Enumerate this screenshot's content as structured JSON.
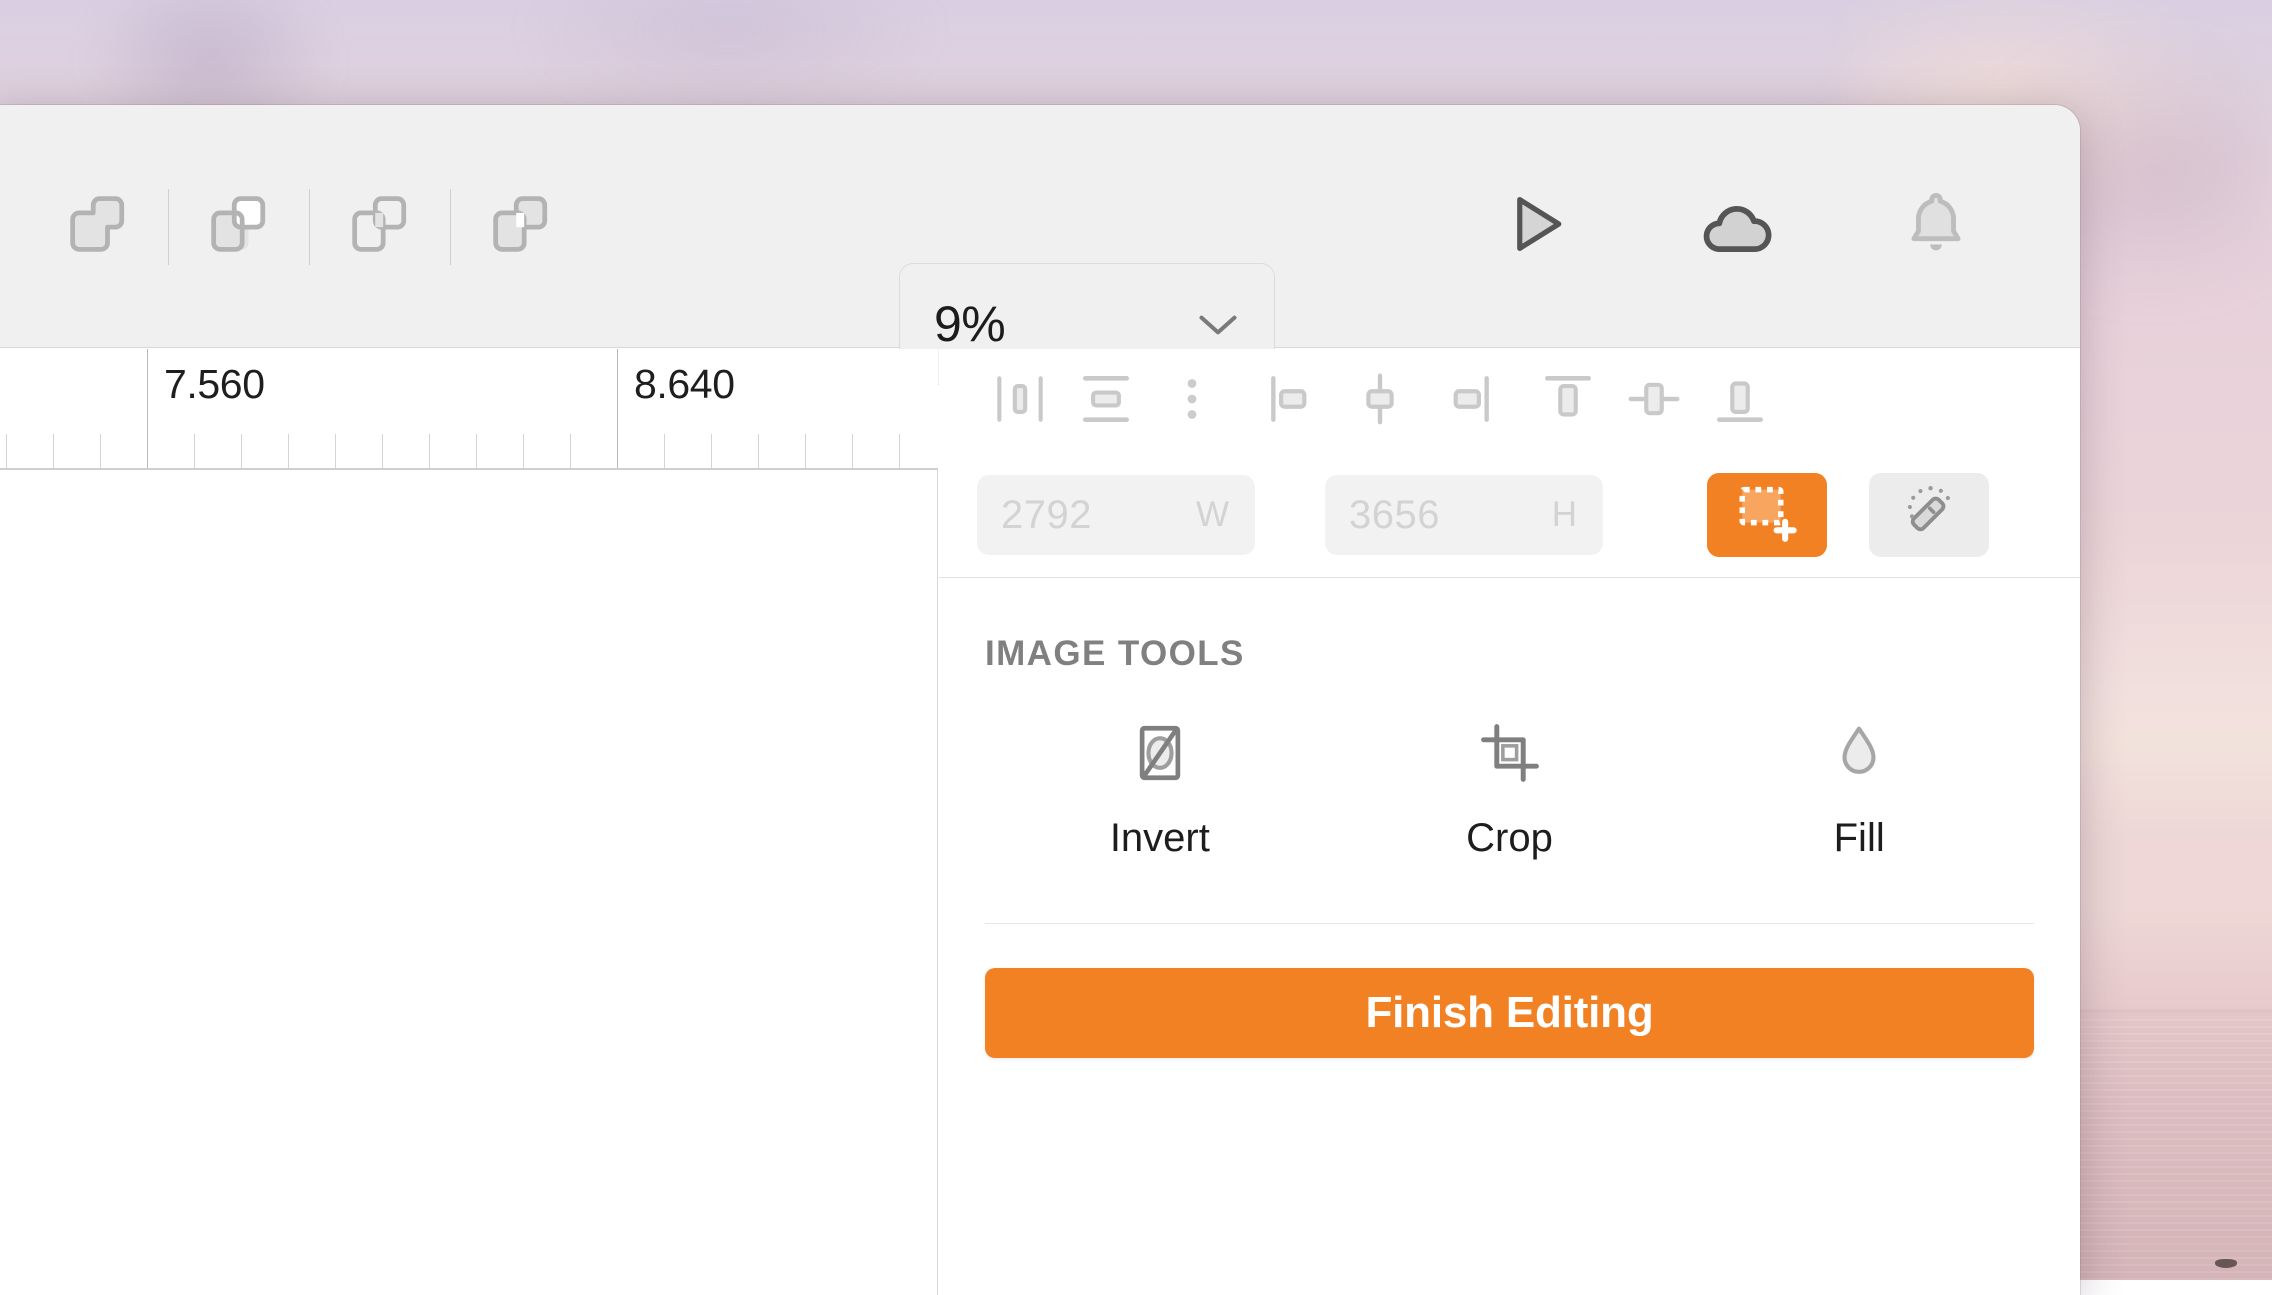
{
  "desktop": {
    "wallpaper_description": "sunset seascape"
  },
  "toolbar": {
    "boolean_tools": [
      {
        "name": "union-button",
        "icon": "boolean-union-icon"
      },
      {
        "name": "subtract-button",
        "icon": "boolean-subtract-icon"
      },
      {
        "name": "intersect-button",
        "icon": "boolean-intersect-icon"
      },
      {
        "name": "difference-button",
        "icon": "boolean-difference-icon"
      }
    ],
    "zoom": {
      "value": "9%",
      "icon": "chevron-down-icon"
    },
    "right_actions": [
      {
        "name": "present-button",
        "icon": "play-icon"
      },
      {
        "name": "cloud-sync-button",
        "icon": "cloud-icon"
      },
      {
        "name": "notifications-button",
        "icon": "bell-icon"
      }
    ]
  },
  "ruler": {
    "labels": [
      "7.560",
      "8.640"
    ]
  },
  "panel": {
    "align_tools": [
      {
        "name": "distribute-horizontal-spacing-button",
        "icon": "distribute-horizontal-icon"
      },
      {
        "name": "distribute-vertical-spacing-button",
        "icon": "distribute-vertical-icon"
      },
      {
        "name": "more-align-options-button",
        "icon": "more-vertical-icon"
      },
      {
        "name": "align-left-button",
        "icon": "align-left-icon"
      },
      {
        "name": "align-horizontal-center-button",
        "icon": "align-center-horizontal-icon"
      },
      {
        "name": "align-right-button",
        "icon": "align-right-icon"
      },
      {
        "name": "align-top-button",
        "icon": "align-top-icon"
      },
      {
        "name": "align-vertical-center-button",
        "icon": "align-center-vertical-icon"
      },
      {
        "name": "align-bottom-button",
        "icon": "align-bottom-icon"
      }
    ],
    "size": {
      "width_value": "2792",
      "width_unit": "W",
      "height_value": "3656",
      "height_unit": "H"
    },
    "selection_tools": [
      {
        "name": "add-selection-button",
        "icon": "marquee-add-icon",
        "active": true
      },
      {
        "name": "magic-wand-button",
        "icon": "magic-wand-icon",
        "active": false
      }
    ],
    "image_tools": {
      "title": "IMAGE TOOLS",
      "items": [
        {
          "label": "Invert",
          "icon": "invert-icon"
        },
        {
          "label": "Crop",
          "icon": "crop-icon"
        },
        {
          "label": "Fill",
          "icon": "droplet-icon"
        }
      ]
    },
    "finish_button_label": "Finish Editing"
  },
  "colors": {
    "accent": "#f28124",
    "toolbar_bg": "#f0f0f0",
    "panel_bg": "#ffffff",
    "icon_stroke": "#b3b3b3",
    "text": "#1d1d1d"
  }
}
